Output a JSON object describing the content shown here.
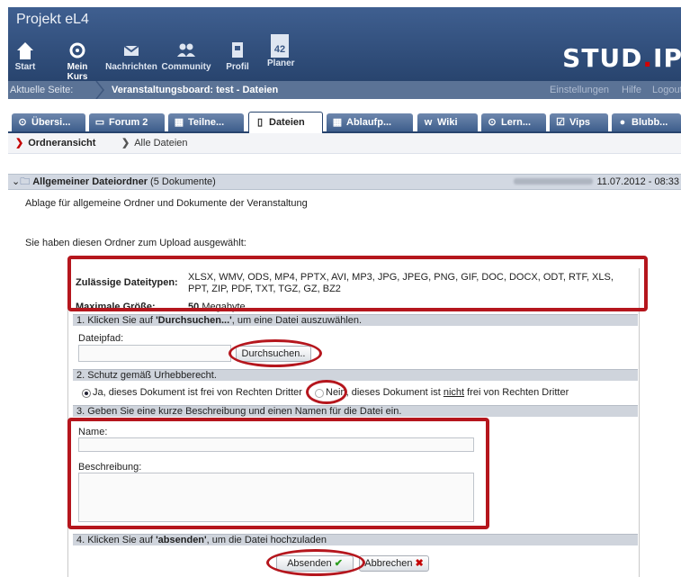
{
  "app": {
    "title": "Projekt eL4",
    "logo_left": "STUD",
    "logo_dot": ".",
    "logo_right": "IP"
  },
  "nav": [
    {
      "label": "Start",
      "icon": "home-icon"
    },
    {
      "label": "Mein Kurs",
      "icon": "course-icon"
    },
    {
      "label": "Nachrichten",
      "icon": "mail-icon"
    },
    {
      "label": "Community",
      "icon": "community-icon"
    },
    {
      "label": "Profil",
      "icon": "profile-icon"
    },
    {
      "label": "Planer",
      "icon": "calendar-icon",
      "badge": "42"
    }
  ],
  "crumb": {
    "label": "Aktuelle Seite:",
    "page": "Veranstaltungsboard: test - Dateien",
    "links": [
      "Einstellungen",
      "Hilfe",
      "Logout"
    ]
  },
  "tabs": [
    {
      "label": "Übersi...",
      "icon": "overview-icon"
    },
    {
      "label": "Forum 2",
      "icon": "forum-icon"
    },
    {
      "label": "Teilne...",
      "icon": "participants-icon"
    },
    {
      "label": "Dateien",
      "icon": "files-icon",
      "active": true
    },
    {
      "label": "Ablaufp...",
      "icon": "schedule-icon"
    },
    {
      "label": "Wiki",
      "icon": "wiki-icon"
    },
    {
      "label": "Lern...",
      "icon": "learning-icon"
    },
    {
      "label": "Vips",
      "icon": "vips-icon"
    },
    {
      "label": "Blubb...",
      "icon": "blubber-icon"
    }
  ],
  "subnav": {
    "folder_view": "Ordneransicht",
    "all_files": "Alle Dateien"
  },
  "folder": {
    "title": "Allgemeiner Dateiordner",
    "count": "(5 Dokumente)",
    "date": "11.07.2012 - 08:33",
    "description": "Ablage für allgemeine Ordner und Dokumente der Veranstaltung",
    "upload_notice": "Sie haben diesen Ordner zum Upload ausgewählt:"
  },
  "upload": {
    "types_label": "Zulässige Dateitypen:",
    "types_line1": "XLSX, WMV, ODS, MP4, PPTX, AVI, MP3, JPG, JPEG, PNG, GIF, DOC, DOCX, ODT, RTF, XLS,",
    "types_line2": "PPT, ZIP, PDF, TXT, TGZ, GZ, BZ2",
    "max_label": "Maximale Größe:",
    "max_value": "50",
    "max_unit": "Megabyte",
    "step1_pre": "1. Klicken Sie auf ",
    "step1_bold": "'Durchsuchen...'",
    "step1_post": ", um eine Datei auszuwählen.",
    "filepath_label": "Dateipfad:",
    "browse_button": "Durchsuchen..",
    "step2": "2. Schutz gemäß Urhebberecht.",
    "radio_yes": "Ja, dieses Dokument ist frei von Rechten Dritter",
    "radio_no_pre": "Nein, dieses Dokument ist ",
    "radio_no_underline": "nicht",
    "radio_no_post": " frei von Rechten Dritter",
    "step3": "3. Geben Sie eine kurze Beschreibung und einen Namen für die Datei ein.",
    "name_label": "Name:",
    "name_value": "",
    "desc_label": "Beschreibung:",
    "desc_value": "",
    "step4_pre": "4. Klicken Sie auf ",
    "step4_bold": "'absenden'",
    "step4_post": ", um die Datei hochzuladen",
    "submit_button": "Absenden",
    "cancel_button": "Abbrechen"
  },
  "colors": {
    "header": "#2f4e7c",
    "annotation": "#b5161d",
    "accent_red": "#c40000",
    "check_green": "#2e9e20"
  }
}
